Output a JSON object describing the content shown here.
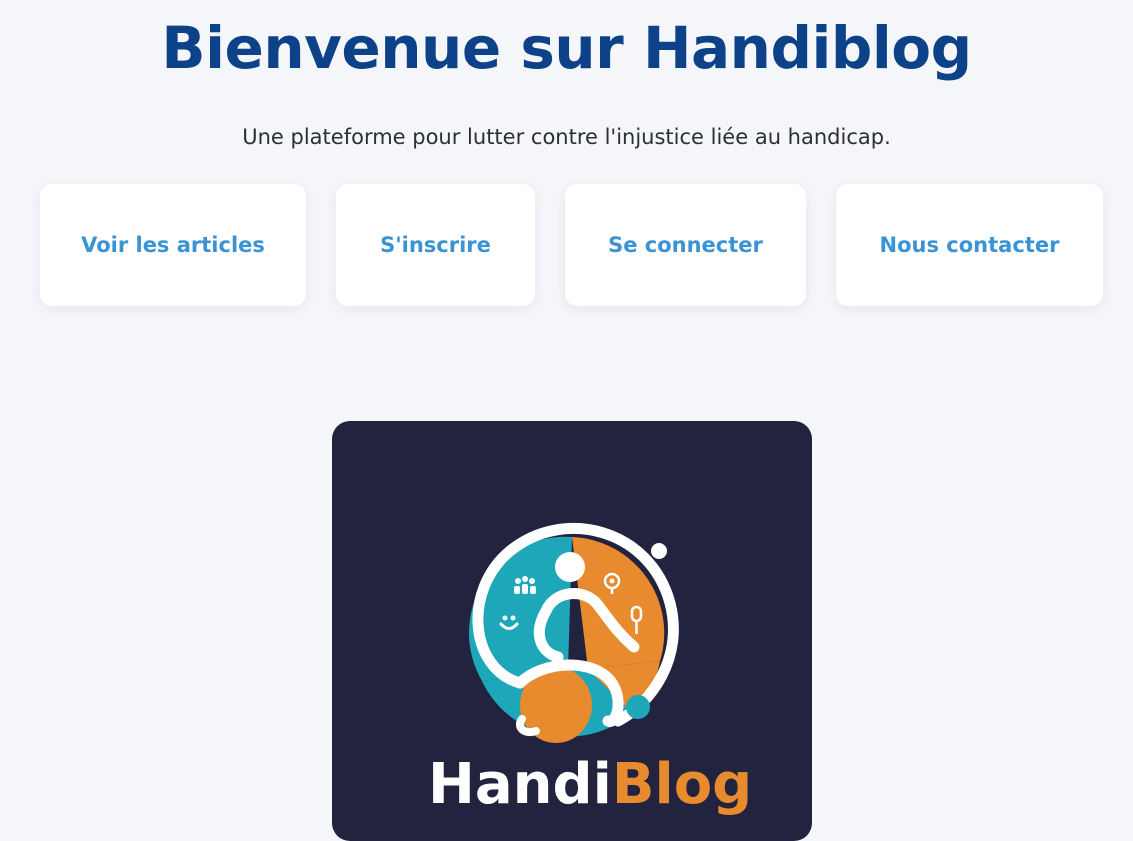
{
  "header": {
    "title": "Bienvenue sur Handiblog",
    "subtitle": "Une plateforme pour lutter contre l'injustice liée au handicap."
  },
  "nav_cards": [
    {
      "label": "Voir les articles"
    },
    {
      "label": "S'inscrire"
    },
    {
      "label": "Se connecter"
    },
    {
      "label": "Nous contacter"
    }
  ],
  "logo": {
    "wordmark_part1": "Handi",
    "wordmark_part2": "Blog"
  },
  "colors": {
    "title": "#0d4289",
    "link": "#3a93d4",
    "background": "#f4f6fa",
    "logo_panel": "#22233f",
    "logo_teal": "#1ea6b9",
    "logo_orange": "#e88b2e"
  }
}
